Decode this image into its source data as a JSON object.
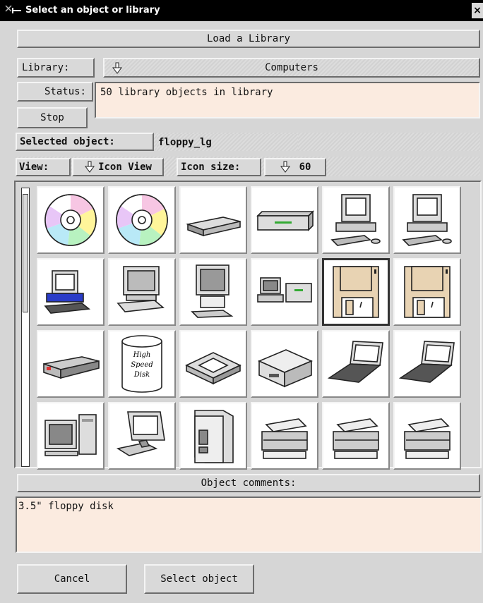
{
  "window": {
    "title": "Select an object or library",
    "close_glyph": "×"
  },
  "load_library": {
    "label": "Load a Library"
  },
  "library": {
    "label": "Library:",
    "value": "Computers",
    "arrow_icon": "down-arrow-icon"
  },
  "status": {
    "label": "Status:",
    "text": "50 library objects in library"
  },
  "stop": {
    "label": "Stop"
  },
  "selected_object": {
    "label": "Selected object:",
    "value": "floppy_lg"
  },
  "view": {
    "label": "View:",
    "value": "Icon View"
  },
  "icon_size": {
    "label": "Icon size:",
    "value": "60"
  },
  "objects": [
    {
      "icon": "cd-rom-icon"
    },
    {
      "icon": "cd-rom-icon"
    },
    {
      "icon": "external-drive-icon"
    },
    {
      "icon": "tape-drive-icon"
    },
    {
      "icon": "workstation-icon"
    },
    {
      "icon": "workstation-icon"
    },
    {
      "icon": "pc-computer-icon"
    },
    {
      "icon": "desktop-computer-icon"
    },
    {
      "icon": "tower-computer-icon"
    },
    {
      "icon": "desktop-system-icon"
    },
    {
      "icon": "floppy-disk-icon",
      "selected": true
    },
    {
      "icon": "floppy-disk-icon"
    },
    {
      "icon": "vcr-drive-icon"
    },
    {
      "icon": "high-speed-disk-icon",
      "text": [
        "High",
        "Speed",
        "Disk"
      ]
    },
    {
      "icon": "scanner-icon"
    },
    {
      "icon": "laser-printer-icon"
    },
    {
      "icon": "laptop-icon"
    },
    {
      "icon": "laptop-icon"
    },
    {
      "icon": "computer-tower-icon"
    },
    {
      "icon": "terminal-icon"
    },
    {
      "icon": "server-icon"
    },
    {
      "icon": "printer-icon"
    },
    {
      "icon": "printer-icon"
    },
    {
      "icon": "printer-icon"
    }
  ],
  "comments": {
    "label": "Object comments:",
    "text": "3.5\" floppy disk"
  },
  "buttons": {
    "cancel": "Cancel",
    "select": "Select object"
  },
  "colors": {
    "field_bg": "#fbebe0",
    "panel_bg": "#d6d6d6",
    "titlebar": "#000000"
  }
}
